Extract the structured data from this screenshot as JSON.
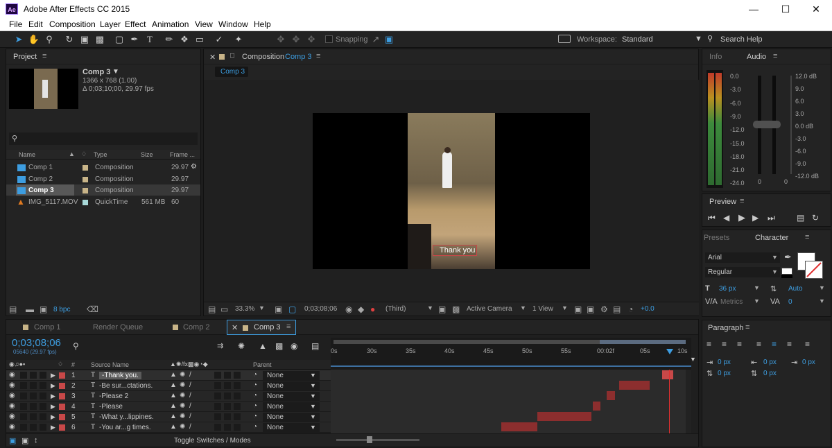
{
  "window": {
    "title": "Adobe After Effects CC 2015",
    "app_badge": "Ae"
  },
  "menu": [
    "File",
    "Edit",
    "Composition",
    "Layer",
    "Effect",
    "Animation",
    "View",
    "Window",
    "Help"
  ],
  "toolbar": {
    "snapping": "Snapping",
    "workspace_label": "Workspace:",
    "workspace_value": "Standard",
    "search_help": "Search Help"
  },
  "project": {
    "tab": "Project",
    "comp_name": "Comp 3",
    "comp_res": "1366 x 768 (1.00)",
    "comp_dur": "Δ 0;03;10;00, 29.97 fps",
    "columns": {
      "name": "Name",
      "type": "Type",
      "size": "Size",
      "frame": "Frame ..."
    },
    "items": [
      {
        "name": "Comp 1",
        "type": "Composition",
        "size": "",
        "frame": "29.97"
      },
      {
        "name": "Comp 2",
        "type": "Composition",
        "size": "",
        "frame": "29.97"
      },
      {
        "name": "Comp 3",
        "type": "Composition",
        "size": "",
        "frame": "29.97"
      },
      {
        "name": "IMG_5117.MOV",
        "type": "QuickTime",
        "size": "561 MB",
        "frame": "60"
      }
    ],
    "bpc": "8 bpc"
  },
  "composition": {
    "header": "Composition",
    "header_comp": "Comp 3",
    "tab": "Comp 3",
    "subtitle": "Thank you",
    "zoom": "33.3%",
    "timecode": "0;03;08;06",
    "resolution": "(Third)",
    "camera": "Active Camera",
    "views": "1 View",
    "exposure": "+0.0"
  },
  "info_audio": {
    "tabs": [
      "Info",
      "Audio"
    ],
    "left_scale": [
      "0.0",
      "-3.0",
      "-6.0",
      "-9.0",
      "-12.0",
      "-15.0",
      "-18.0",
      "-21.0",
      "-24.0"
    ],
    "right_scale": [
      "12.0 dB",
      "9.0",
      "6.0",
      "3.0",
      "0.0 dB",
      "-3.0",
      "-6.0",
      "-9.0",
      "-12.0 dB"
    ],
    "slider_bottom": [
      "0",
      "0"
    ]
  },
  "preview": {
    "tab": "Preview"
  },
  "character": {
    "tabs": [
      "Presets",
      "Character"
    ],
    "font": "Arial",
    "style": "Regular",
    "size": "36 px",
    "leading": "Auto",
    "kerning": "Metrics",
    "tracking": "0"
  },
  "paragraph": {
    "tab": "Paragraph",
    "values": [
      "0 px",
      "0 px",
      "0 px",
      "0 px",
      "0 px"
    ]
  },
  "timeline": {
    "tabs": [
      "Comp 1",
      "Render Queue",
      "Comp 2",
      "Comp 3"
    ],
    "timecode": "0;03;08;06",
    "frame_info": "05640 (29.97 fps)",
    "columns": {
      "num": "#",
      "source": "Source Name",
      "parent": "Parent"
    },
    "ruler": [
      "0s",
      "30s",
      "35s",
      "40s",
      "45s",
      "50s",
      "55s",
      "00:02f",
      "05s",
      "10s"
    ],
    "layers": [
      {
        "num": "1",
        "name": "-Thank you.",
        "parent": "None"
      },
      {
        "num": "2",
        "name": "-Be sur...ctations.",
        "parent": "None"
      },
      {
        "num": "3",
        "name": "-Please 2",
        "parent": "None"
      },
      {
        "num": "4",
        "name": "-Please",
        "parent": "None"
      },
      {
        "num": "5",
        "name": "-What y...lippines.",
        "parent": "None"
      },
      {
        "num": "6",
        "name": "-You ar...g times.",
        "parent": "None"
      }
    ],
    "toggle": "Toggle Switches / Modes"
  },
  "colors": {
    "accent": "#3d9de0",
    "layer_label": "#c84848",
    "bar": "#8c2e2e",
    "panel": "#232323"
  }
}
